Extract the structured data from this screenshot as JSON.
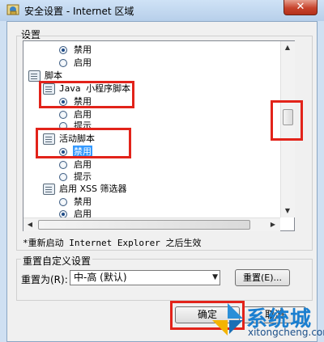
{
  "window": {
    "title": "安全设置 - Internet 区域",
    "close_glyph": "✕"
  },
  "settings_label": "设置",
  "tree": {
    "row_disable_top": "禁用",
    "row_enable_top": "启用",
    "scripting": "脚本",
    "java_applet": "Java 小程序脚本",
    "java_disable": "禁用",
    "java_enable": "启用",
    "java_prompt": "提示",
    "active_script": "活动脚本",
    "active_disable": "禁用",
    "active_enable": "启用",
    "active_prompt": "提示",
    "xss_filter": "启用 XSS 筛选器",
    "xss_disable": "禁用",
    "xss_enable": "启用"
  },
  "note": "*重新启动 Internet Explorer 之后生效",
  "reset": {
    "group_label": "重置自定义设置",
    "reset_to_label": "重置为(R):",
    "selected_level": "中-高 (默认)",
    "reset_button": "重置(E)..."
  },
  "buttons": {
    "ok": "确定",
    "cancel": "取消"
  },
  "watermark": {
    "name": "系统城",
    "url": "xitongcheng.com"
  },
  "colors": {
    "annotation_red": "#e2231a",
    "selection_blue": "#3399ff"
  }
}
